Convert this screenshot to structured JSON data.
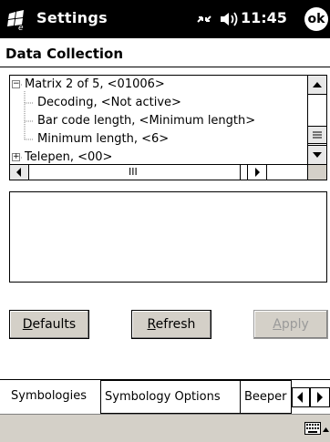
{
  "titlebar": {
    "title": "Settings",
    "time": "11:45",
    "ok_label": "ok",
    "icons": [
      "windows-start-icon",
      "connectivity-icon",
      "volume-icon"
    ]
  },
  "page": {
    "title": "Data Collection"
  },
  "tree": {
    "items": [
      {
        "label": "Matrix 2 of 5, <01006>",
        "expander": "−"
      },
      {
        "label": "Decoding, <Not active>"
      },
      {
        "label": "Bar code length, <Minimum length>"
      },
      {
        "label": "Minimum length, <6>"
      },
      {
        "label": "Telepen, <00>",
        "expander": "+"
      }
    ],
    "hscroll_thumb_glyph": "III"
  },
  "buttons": {
    "defaults_label": "efaults",
    "defaults_mnemonic": "D",
    "refresh_label": "efresh",
    "refresh_mnemonic": "R",
    "apply_label": "pply",
    "apply_mnemonic": "A"
  },
  "tabs": {
    "items": [
      {
        "label": "Symbologies"
      },
      {
        "label": "Symbology Options"
      },
      {
        "label": "Beeper"
      }
    ],
    "active_index": 0
  },
  "colors": {
    "titlebar_bg": "#000000",
    "button_face": "#d4d0c8",
    "disabled_text": "#9a9a9a"
  }
}
